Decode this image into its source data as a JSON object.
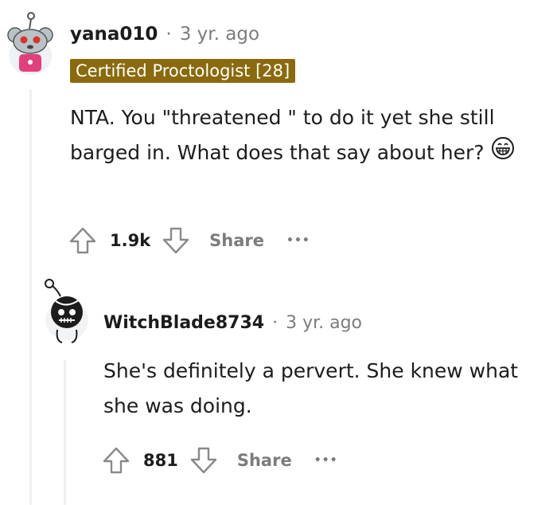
{
  "comments": [
    {
      "username": "yana010",
      "separator": "·",
      "age": "3 yr. ago",
      "flair": "Certified Proctologist [28]",
      "body": "NTA. You \"threatened \" to do it yet she still barged in. What does that say about her?",
      "emoji": "grinning-face-emoji",
      "score": "1.9k",
      "share_label": "Share",
      "more_label": "•••"
    },
    {
      "username": "WitchBlade8734",
      "separator": "·",
      "age": "3 yr. ago",
      "body": "She's definitely a pervert. She knew what she was doing.",
      "score": "881",
      "share_label": "Share",
      "more_label": "•••"
    }
  ],
  "colors": {
    "flair_bg": "#8a6a0d",
    "muted_text": "#7c7c7c",
    "thread_line": "#edeff1"
  },
  "icons": {
    "upvote": "arrow-up-outline",
    "downvote": "arrow-down-outline",
    "more": "horizontal-ellipsis"
  }
}
